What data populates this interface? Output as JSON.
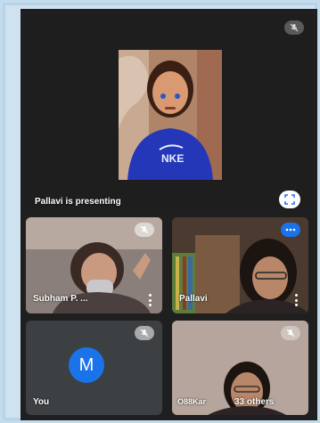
{
  "main_tile": {
    "presenter_label": "Pallavi is presenting"
  },
  "tiles": [
    {
      "name": "Subham P. ..."
    },
    {
      "name": "Pallavi"
    },
    {
      "name": "You",
      "avatar_letter": "M"
    },
    {
      "name": "O88Kar",
      "others_label": "33 others"
    }
  ],
  "colors": {
    "screen_bg": "#1f1f1f",
    "tile_bg": "#3c4043",
    "avatar_bg": "#1a73e8",
    "speaking_badge": "#1a73e8",
    "outer_frame": "#c3dcec"
  },
  "icons": [
    "mic-off-icon",
    "fullscreen-icon",
    "more-options-icon",
    "speaking-indicator-icon"
  ]
}
